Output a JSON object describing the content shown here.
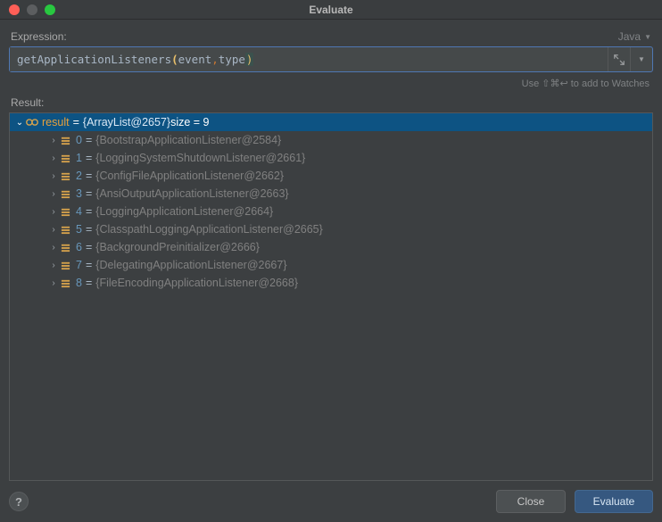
{
  "window": {
    "title": "Evaluate"
  },
  "labels": {
    "expression": "Expression:",
    "result": "Result:",
    "hint_prefix": "Use ",
    "hint_keys": "⇧⌘↩",
    "hint_suffix": " to add to Watches",
    "language": "Java"
  },
  "expression": {
    "fn": "getApplicationListeners",
    "open_paren": "(",
    "arg1": "event",
    "comma": ",",
    "space": " ",
    "arg2": "type",
    "close_paren": ")"
  },
  "result": {
    "name": "result",
    "eq": " = ",
    "value_ref": "{ArrayList@2657}",
    "size_text": " size = 9",
    "items": [
      {
        "index": "0",
        "ref": "{BootstrapApplicationListener@2584}"
      },
      {
        "index": "1",
        "ref": "{LoggingSystemShutdownListener@2661}"
      },
      {
        "index": "2",
        "ref": "{ConfigFileApplicationListener@2662}"
      },
      {
        "index": "3",
        "ref": "{AnsiOutputApplicationListener@2663}"
      },
      {
        "index": "4",
        "ref": "{LoggingApplicationListener@2664}"
      },
      {
        "index": "5",
        "ref": "{ClasspathLoggingApplicationListener@2665}"
      },
      {
        "index": "6",
        "ref": "{BackgroundPreinitializer@2666}"
      },
      {
        "index": "7",
        "ref": "{DelegatingApplicationListener@2667}"
      },
      {
        "index": "8",
        "ref": "{FileEncodingApplicationListener@2668}"
      }
    ]
  },
  "buttons": {
    "close": "Close",
    "evaluate": "Evaluate",
    "help": "?"
  }
}
